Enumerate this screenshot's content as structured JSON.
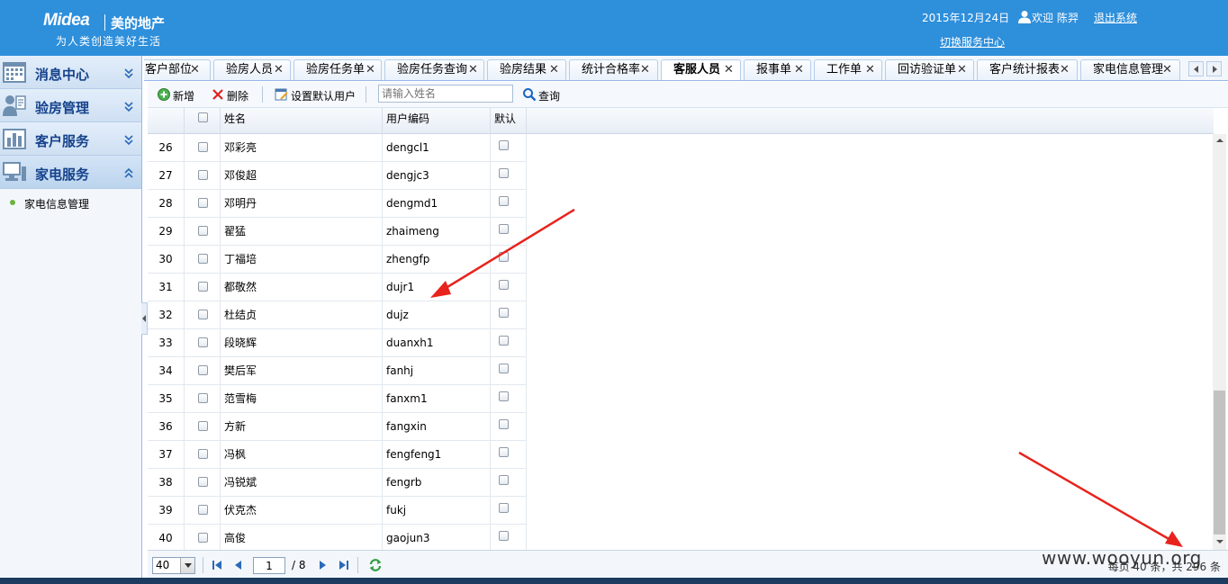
{
  "header": {
    "brand": "Midea",
    "brand_cn": "美的地产",
    "slogan": "为人类创造美好生活",
    "date": "2015年12月24日",
    "welcome": "欢迎 陈羿",
    "logout": "退出系统",
    "switch_center": "切换服务中心"
  },
  "sidebar": {
    "sections": [
      {
        "label": "消息中心",
        "icon": "calendar-icon"
      },
      {
        "label": "验房管理",
        "icon": "inspection-icon"
      },
      {
        "label": "客户服务",
        "icon": "bar-chart-icon"
      },
      {
        "label": "家电服务",
        "icon": "computer-icon"
      }
    ],
    "sub_items": [
      "家电信息管理"
    ]
  },
  "tabs": [
    {
      "label": "客户部位"
    },
    {
      "label": "验房人员"
    },
    {
      "label": "验房任务单"
    },
    {
      "label": "验房任务查询"
    },
    {
      "label": "验房结果"
    },
    {
      "label": "统计合格率"
    },
    {
      "label": "客服人员",
      "active": true
    },
    {
      "label": "报事单"
    },
    {
      "label": "工作单"
    },
    {
      "label": "回访验证单"
    },
    {
      "label": "客户统计报表"
    },
    {
      "label": "家电信息管理"
    }
  ],
  "toolbar": {
    "add": "新增",
    "delete": "删除",
    "set_default": "设置默认用户",
    "search_placeholder": "请输入姓名",
    "query": "查询"
  },
  "grid": {
    "columns": {
      "name": "姓名",
      "code": "用户编码",
      "default": "默认"
    },
    "rows": [
      {
        "num": "26",
        "name": "邓彩亮",
        "code": "dengcl1"
      },
      {
        "num": "27",
        "name": "邓俊超",
        "code": "dengjc3"
      },
      {
        "num": "28",
        "name": "邓明丹",
        "code": "dengmd1"
      },
      {
        "num": "29",
        "name": "翟猛",
        "code": "zhaimeng"
      },
      {
        "num": "30",
        "name": "丁福培",
        "code": "zhengfp"
      },
      {
        "num": "31",
        "name": "都敬然",
        "code": "dujr1"
      },
      {
        "num": "32",
        "name": "杜结贞",
        "code": "dujz"
      },
      {
        "num": "33",
        "name": "段晓辉",
        "code": "duanxh1"
      },
      {
        "num": "34",
        "name": "樊后军",
        "code": "fanhj"
      },
      {
        "num": "35",
        "name": "范雪梅",
        "code": "fanxm1"
      },
      {
        "num": "36",
        "name": "方新",
        "code": "fangxin"
      },
      {
        "num": "37",
        "name": "冯枫",
        "code": "fengfeng1"
      },
      {
        "num": "38",
        "name": "冯锐斌",
        "code": "fengrb"
      },
      {
        "num": "39",
        "name": "伏克杰",
        "code": "fukj"
      },
      {
        "num": "40",
        "name": "高俊",
        "code": "gaojun3"
      }
    ]
  },
  "pager": {
    "page_size": "40",
    "current_page": "1",
    "total_pages": "/ 8",
    "info": "每页 40 条，共 296 条"
  },
  "watermark": "www.wooyun.org",
  "colors": {
    "header_bg": "#2e8fdb",
    "accent_text": "#15428b",
    "annotation_red": "#e8231d"
  }
}
